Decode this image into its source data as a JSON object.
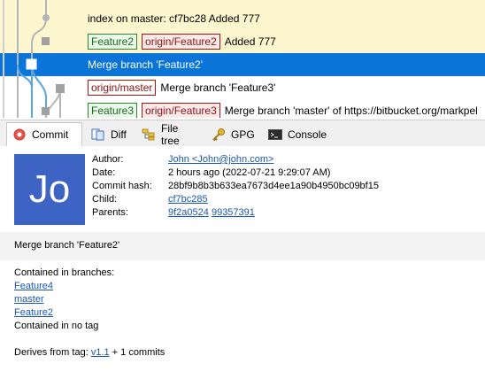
{
  "graph": {
    "rows": [
      {
        "text": "index on master: cf7bc28 Added 777",
        "tags": []
      },
      {
        "text": "Added 777",
        "tags": [
          {
            "label": "Feature2",
            "kind": "green"
          },
          {
            "label": "origin/Feature2",
            "kind": "red"
          }
        ]
      },
      {
        "text": "Merge branch 'Feature2'",
        "tags": []
      },
      {
        "text": "Merge branch 'Feature3'",
        "tags": [
          {
            "label": "origin/master",
            "kind": "red"
          }
        ]
      },
      {
        "text": "Merge branch 'master' of https://bitbucket.org/markpel",
        "tags": [
          {
            "label": "Feature3",
            "kind": "green"
          },
          {
            "label": "origin/Feature3",
            "kind": "red"
          }
        ]
      }
    ]
  },
  "tabs": [
    {
      "label": "Commit",
      "icon": "commit-icon"
    },
    {
      "label": "Diff",
      "icon": "diff-icon"
    },
    {
      "label": "File tree",
      "icon": "file-tree-icon"
    },
    {
      "label": "GPG",
      "icon": "key-icon"
    },
    {
      "label": "Console",
      "icon": "console-icon"
    }
  ],
  "commit": {
    "avatar_initials": "Jo",
    "labels": {
      "author": "Author:",
      "date": "Date:",
      "hash": "Commit hash:",
      "child": "Child:",
      "parents": "Parents:"
    },
    "author": "John <John@john.com>",
    "date": "2 hours ago (2022-07-21 9:29:07 AM)",
    "hash": "28bf9b8b3b633ea7673d4ee1a90b4950bc09bf15",
    "child": "cf7bc285",
    "parents": [
      "9f2a0524",
      "99357391"
    ],
    "message": "Merge branch 'Feature2'",
    "contained_in_branches_label": "Contained in branches:",
    "branches": [
      "Feature4",
      "master",
      "Feature2"
    ],
    "contained_tag_text": "Contained in no tag",
    "derives_prefix": "Derives from tag: ",
    "derives_tag": "v1.1",
    "derives_suffix": " + 1 commits"
  },
  "colors": {
    "selected": "#0a74d8",
    "highlight": "#fdf6cf",
    "lane_blue": "#5aa6e0",
    "lane_gray": "#b5b5b5",
    "avatar": "#3d64c4"
  }
}
